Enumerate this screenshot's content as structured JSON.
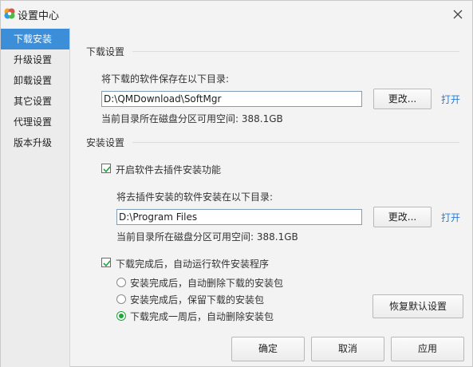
{
  "window": {
    "title": "设置中心"
  },
  "sidebar": {
    "items": [
      {
        "label": "下载安装",
        "active": true
      },
      {
        "label": "升级设置",
        "active": false
      },
      {
        "label": "卸载设置",
        "active": false
      },
      {
        "label": "其它设置",
        "active": false
      },
      {
        "label": "代理设置",
        "active": false
      },
      {
        "label": "版本升级",
        "active": false
      }
    ]
  },
  "download": {
    "section_title": "下载设置",
    "dir_label": "将下载的软件保存在以下目录:",
    "dir_value": "D:\\QMDownload\\SoftMgr",
    "change_label": "更改...",
    "open_label": "打开",
    "space_text": "当前目录所在磁盘分区可用空间: 388.1GB"
  },
  "install": {
    "section_title": "安装设置",
    "plugin_checkbox_label": "开启软件去插件安装功能",
    "plugin_checked": true,
    "dir_label": "将去插件安装的软件安装在以下目录:",
    "dir_value": "D:\\Program Files",
    "change_label": "更改...",
    "open_label": "打开",
    "space_text": "当前目录所在磁盘分区可用空间: 388.1GB",
    "autorun_checkbox_label": "下载完成后，自动运行软件安装程序",
    "autorun_checked": true,
    "radios": [
      {
        "label": "安装完成后，自动删除下载的安装包",
        "checked": false
      },
      {
        "label": "安装完成后，保留下载的安装包",
        "checked": false
      },
      {
        "label": "下载完成一周后，自动删除安装包",
        "checked": true
      }
    ],
    "restore_label": "恢复默认设置"
  },
  "footer": {
    "ok_label": "确定",
    "cancel_label": "取消",
    "apply_label": "应用"
  },
  "colors": {
    "accent": "#3c8ed8",
    "link": "#2a7bd6",
    "radio_checked": "#1fa53a"
  }
}
